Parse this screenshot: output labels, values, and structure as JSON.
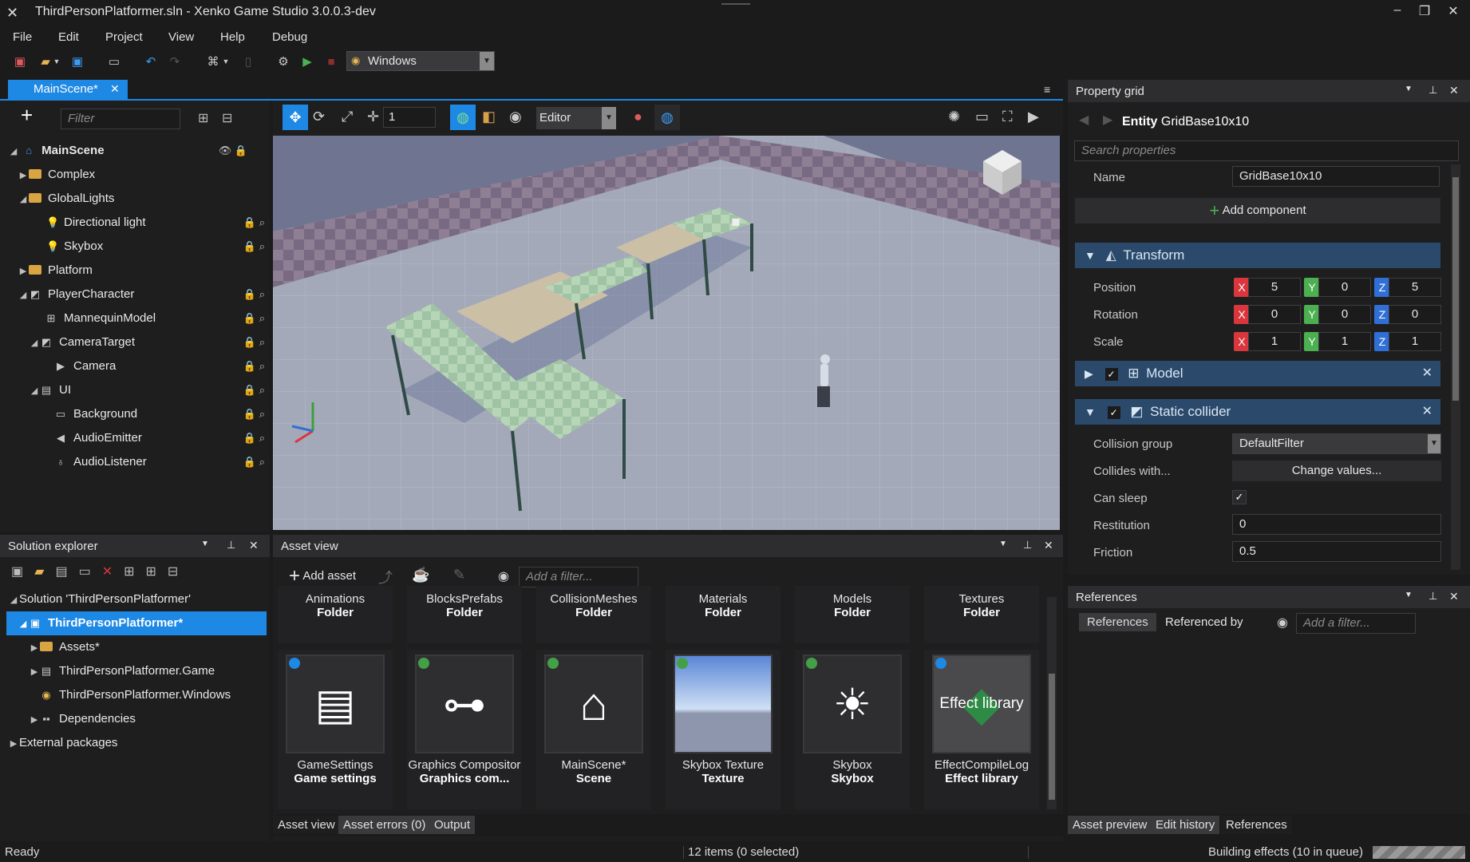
{
  "window": {
    "title": "ThirdPersonPlatformer.sln - Xenko Game Studio 3.0.0.3-dev"
  },
  "menu": [
    "File",
    "Edit",
    "Project",
    "View",
    "Help",
    "Debug"
  ],
  "toolbar": {
    "platform": "Windows"
  },
  "scene_tab": {
    "label": "MainScene*"
  },
  "scene_tree": {
    "filter_placeholder": "Filter",
    "items": [
      {
        "label": "MainScene",
        "depth": 0
      },
      {
        "label": "Complex",
        "depth": 1
      },
      {
        "label": "GlobalLights",
        "depth": 1
      },
      {
        "label": "Directional light",
        "depth": 2
      },
      {
        "label": "Skybox",
        "depth": 2
      },
      {
        "label": "Platform",
        "depth": 1
      },
      {
        "label": "PlayerCharacter",
        "depth": 1
      },
      {
        "label": "MannequinModel",
        "depth": 2
      },
      {
        "label": "CameraTarget",
        "depth": 2
      },
      {
        "label": "Camera",
        "depth": 3
      },
      {
        "label": "UI",
        "depth": 2
      },
      {
        "label": "Background",
        "depth": 3
      },
      {
        "label": "AudioEmitter",
        "depth": 3
      },
      {
        "label": "AudioListener",
        "depth": 3
      }
    ]
  },
  "viewport_toolbar": {
    "snap_value": "1",
    "camera_mode": "Editor"
  },
  "solution": {
    "title": "Solution explorer",
    "items": [
      {
        "label": "Solution 'ThirdPersonPlatformer'"
      },
      {
        "label": "ThirdPersonPlatformer*"
      },
      {
        "label": "Assets*"
      },
      {
        "label": "ThirdPersonPlatformer.Game"
      },
      {
        "label": "ThirdPersonPlatformer.Windows"
      },
      {
        "label": "Dependencies"
      },
      {
        "label": "External packages"
      }
    ]
  },
  "asset_view": {
    "title": "Asset view",
    "add_label": "Add asset",
    "filter_placeholder": "Add a filter...",
    "folders": [
      {
        "name": "Animations",
        "type": "Folder"
      },
      {
        "name": "BlocksPrefabs",
        "type": "Folder"
      },
      {
        "name": "CollisionMeshes",
        "type": "Folder"
      },
      {
        "name": "Materials",
        "type": "Folder"
      },
      {
        "name": "Models",
        "type": "Folder"
      },
      {
        "name": "Textures",
        "type": "Folder"
      }
    ],
    "assets": [
      {
        "name": "GameSettings",
        "type": "Game settings",
        "dot": "#1e88e5"
      },
      {
        "name": "Graphics Compositor",
        "type": "Graphics com...",
        "dot": "#43a047"
      },
      {
        "name": "MainScene*",
        "type": "Scene",
        "dot": "#43a047"
      },
      {
        "name": "Skybox Texture",
        "type": "Texture",
        "dot": "#43a047"
      },
      {
        "name": "Skybox",
        "type": "Skybox",
        "dot": "#43a047"
      },
      {
        "name": "EffectCompileLog",
        "type": "Effect library",
        "dot": "#1e88e5",
        "thumb_text": "Effect library"
      }
    ],
    "tabs": [
      "Asset view",
      "Asset errors (0)",
      "Output"
    ]
  },
  "property_grid": {
    "title": "Property grid",
    "entity_label": "Entity",
    "entity_name": "GridBase10x10",
    "search_placeholder": "Search properties",
    "name_label": "Name",
    "name_value": "GridBase10x10",
    "add_component": "Add component",
    "transform": {
      "title": "Transform",
      "position_label": "Position",
      "position": [
        "5",
        "0",
        "5"
      ],
      "rotation_label": "Rotation",
      "rotation": [
        "0",
        "0",
        "0"
      ],
      "scale_label": "Scale",
      "scale": [
        "1",
        "1",
        "1"
      ]
    },
    "model": {
      "title": "Model"
    },
    "collider": {
      "title": "Static collider",
      "collision_group_label": "Collision group",
      "collision_group": "DefaultFilter",
      "collides_label": "Collides with...",
      "collides_button": "Change values...",
      "can_sleep_label": "Can sleep",
      "restitution_label": "Restitution",
      "restitution": "0",
      "friction_label": "Friction",
      "friction": "0.5"
    }
  },
  "references": {
    "title": "References",
    "tab_refs": "References",
    "tab_refby": "Referenced by",
    "filter_placeholder": "Add a filter...",
    "bottom_tabs": [
      "Asset preview",
      "Edit history",
      "References"
    ]
  },
  "status": {
    "left": "Ready",
    "center": "12 items (0 selected)",
    "right": "Building effects (10 in queue)"
  },
  "colors": {
    "accent": "#1e88e5",
    "axis_x": "#d9363e",
    "axis_y": "#4caf50",
    "axis_z": "#2f6fd6",
    "section": "#2b4a6b"
  }
}
